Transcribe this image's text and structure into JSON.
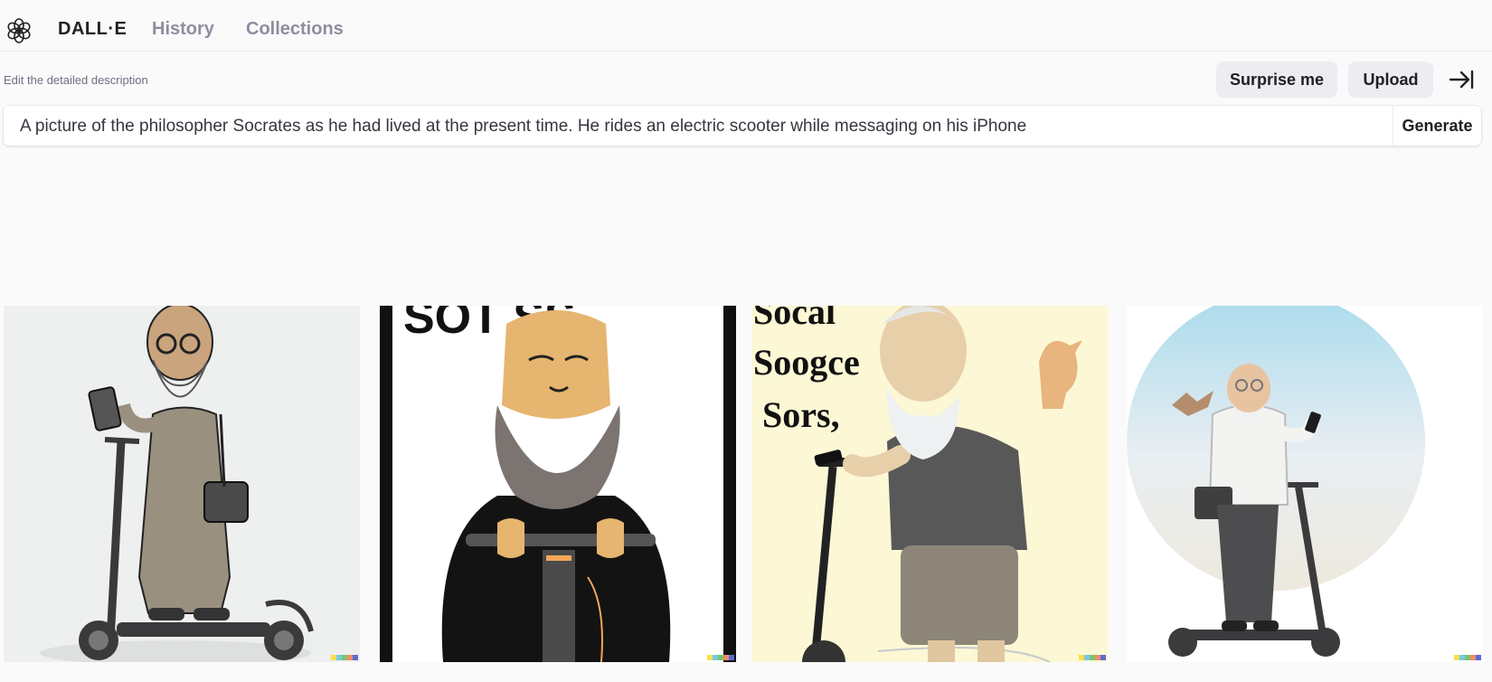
{
  "nav": {
    "brand": "DALL·E",
    "links": [
      "History",
      "Collections"
    ]
  },
  "prompt": {
    "hint": "Edit the detailed description",
    "text": "A picture of the philosopher Socrates as he had lived at the present time. He rides an electric scooter while messaging on his iPhone",
    "generate_label": "Generate"
  },
  "actions": {
    "surprise_label": "Surprise me",
    "upload_label": "Upload"
  },
  "results": [
    {
      "style": "sketch-gray"
    },
    {
      "style": "cartoon-poster",
      "caption": "SOT SS"
    },
    {
      "style": "3d-render-yellow",
      "caption_lines": [
        "Socal",
        "Soogce",
        "Sors,"
      ]
    },
    {
      "style": "circle-sky"
    }
  ],
  "watermark_colors": [
    "#f7e14b",
    "#78c8e6",
    "#76c56f",
    "#f18c62",
    "#5b6bd1"
  ],
  "colors": {
    "background": "#fafafa",
    "muted_text": "#8e8ea0",
    "button_bg": "#ececf1"
  }
}
